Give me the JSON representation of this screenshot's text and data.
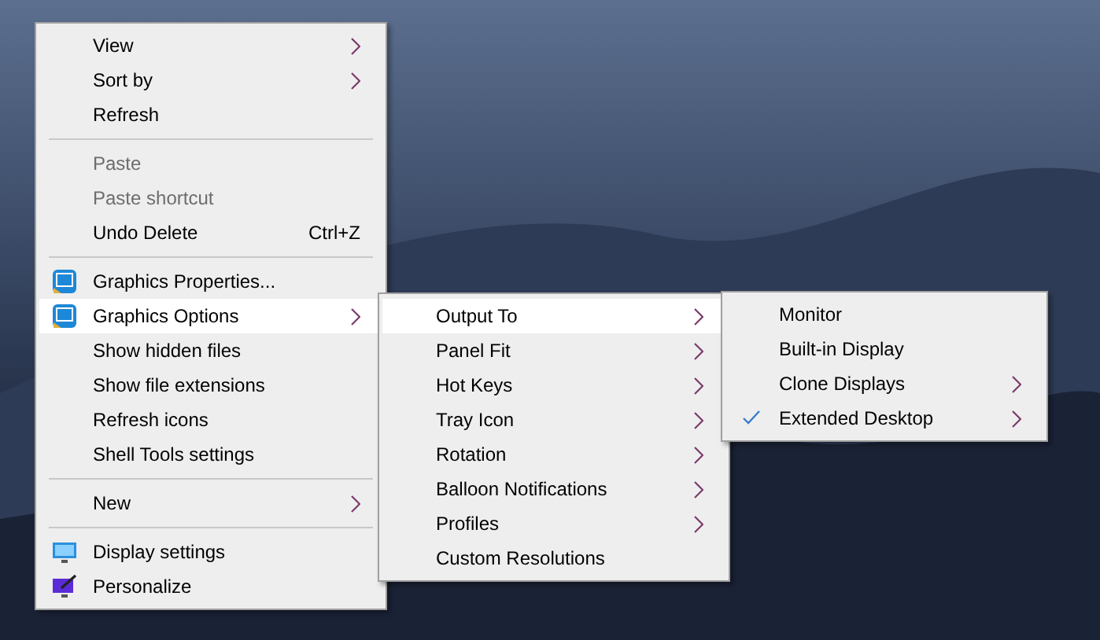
{
  "context_menu": {
    "items": [
      {
        "kind": "plain",
        "label": "View",
        "submenu": true,
        "disabled": false,
        "selected": false
      },
      {
        "kind": "plain",
        "label": "Sort by",
        "submenu": true,
        "disabled": false,
        "selected": false
      },
      {
        "kind": "plain",
        "label": "Refresh",
        "submenu": false,
        "disabled": false,
        "selected": false
      },
      {
        "kind": "separator"
      },
      {
        "kind": "plain",
        "label": "Paste",
        "submenu": false,
        "disabled": true,
        "selected": false
      },
      {
        "kind": "plain",
        "label": "Paste shortcut",
        "submenu": false,
        "disabled": true,
        "selected": false
      },
      {
        "kind": "plain",
        "label": "Undo Delete",
        "shortcut": "Ctrl+Z",
        "submenu": false,
        "disabled": false,
        "selected": false
      },
      {
        "kind": "separator"
      },
      {
        "kind": "graphics",
        "label": "Graphics Properties...",
        "submenu": false,
        "disabled": false,
        "selected": false
      },
      {
        "kind": "graphics",
        "label": "Graphics Options",
        "submenu": true,
        "disabled": false,
        "selected": true
      },
      {
        "kind": "plain",
        "label": "Show hidden files",
        "submenu": false,
        "disabled": false,
        "selected": false
      },
      {
        "kind": "plain",
        "label": "Show file extensions",
        "submenu": false,
        "disabled": false,
        "selected": false
      },
      {
        "kind": "plain",
        "label": "Refresh icons",
        "submenu": false,
        "disabled": false,
        "selected": false
      },
      {
        "kind": "plain",
        "label": "Shell Tools settings",
        "submenu": false,
        "disabled": false,
        "selected": false
      },
      {
        "kind": "separator"
      },
      {
        "kind": "plain",
        "label": "New",
        "submenu": true,
        "disabled": false,
        "selected": false
      },
      {
        "kind": "separator"
      },
      {
        "kind": "display",
        "label": "Display settings",
        "submenu": false,
        "disabled": false,
        "selected": false
      },
      {
        "kind": "personalize",
        "label": "Personalize",
        "submenu": false,
        "disabled": false,
        "selected": false
      }
    ]
  },
  "graphics_options_menu": {
    "items": [
      {
        "kind": "plain",
        "label": "Output To",
        "submenu": true,
        "disabled": false,
        "selected": true
      },
      {
        "kind": "plain",
        "label": "Panel Fit",
        "submenu": true,
        "disabled": false,
        "selected": false
      },
      {
        "kind": "plain",
        "label": "Hot Keys",
        "submenu": true,
        "disabled": false,
        "selected": false
      },
      {
        "kind": "plain",
        "label": "Tray Icon",
        "submenu": true,
        "disabled": false,
        "selected": false
      },
      {
        "kind": "plain",
        "label": "Rotation",
        "submenu": true,
        "disabled": false,
        "selected": false
      },
      {
        "kind": "plain",
        "label": "Balloon Notifications",
        "submenu": true,
        "disabled": false,
        "selected": false
      },
      {
        "kind": "plain",
        "label": "Profiles",
        "submenu": true,
        "disabled": false,
        "selected": false
      },
      {
        "kind": "plain",
        "label": "Custom Resolutions",
        "submenu": false,
        "disabled": false,
        "selected": false
      }
    ]
  },
  "output_to_menu": {
    "items": [
      {
        "kind": "plain",
        "label": "Monitor",
        "submenu": false,
        "disabled": false,
        "selected": false,
        "checked": false
      },
      {
        "kind": "plain",
        "label": "Built-in Display",
        "submenu": false,
        "disabled": false,
        "selected": false,
        "checked": false
      },
      {
        "kind": "plain",
        "label": "Clone Displays",
        "submenu": true,
        "disabled": false,
        "selected": false,
        "checked": false
      },
      {
        "kind": "plain",
        "label": "Extended Desktop",
        "submenu": true,
        "disabled": false,
        "selected": false,
        "checked": true
      }
    ]
  }
}
